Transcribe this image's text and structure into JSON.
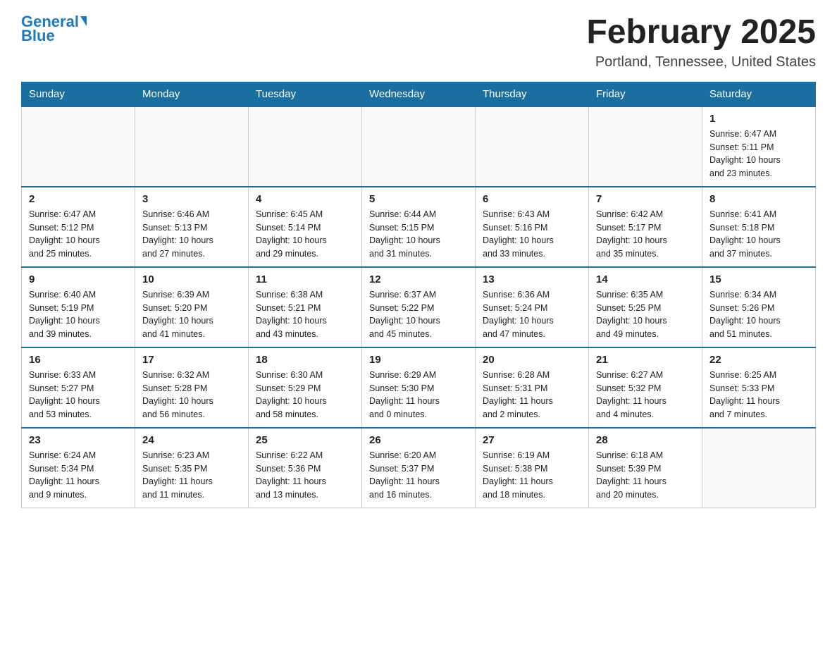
{
  "logo": {
    "general": "General",
    "blue": "Blue",
    "triangle": "▶"
  },
  "title": "February 2025",
  "location": "Portland, Tennessee, United States",
  "days_of_week": [
    "Sunday",
    "Monday",
    "Tuesday",
    "Wednesday",
    "Thursday",
    "Friday",
    "Saturday"
  ],
  "weeks": [
    [
      {
        "day": "",
        "info": ""
      },
      {
        "day": "",
        "info": ""
      },
      {
        "day": "",
        "info": ""
      },
      {
        "day": "",
        "info": ""
      },
      {
        "day": "",
        "info": ""
      },
      {
        "day": "",
        "info": ""
      },
      {
        "day": "1",
        "info": "Sunrise: 6:47 AM\nSunset: 5:11 PM\nDaylight: 10 hours\nand 23 minutes."
      }
    ],
    [
      {
        "day": "2",
        "info": "Sunrise: 6:47 AM\nSunset: 5:12 PM\nDaylight: 10 hours\nand 25 minutes."
      },
      {
        "day": "3",
        "info": "Sunrise: 6:46 AM\nSunset: 5:13 PM\nDaylight: 10 hours\nand 27 minutes."
      },
      {
        "day": "4",
        "info": "Sunrise: 6:45 AM\nSunset: 5:14 PM\nDaylight: 10 hours\nand 29 minutes."
      },
      {
        "day": "5",
        "info": "Sunrise: 6:44 AM\nSunset: 5:15 PM\nDaylight: 10 hours\nand 31 minutes."
      },
      {
        "day": "6",
        "info": "Sunrise: 6:43 AM\nSunset: 5:16 PM\nDaylight: 10 hours\nand 33 minutes."
      },
      {
        "day": "7",
        "info": "Sunrise: 6:42 AM\nSunset: 5:17 PM\nDaylight: 10 hours\nand 35 minutes."
      },
      {
        "day": "8",
        "info": "Sunrise: 6:41 AM\nSunset: 5:18 PM\nDaylight: 10 hours\nand 37 minutes."
      }
    ],
    [
      {
        "day": "9",
        "info": "Sunrise: 6:40 AM\nSunset: 5:19 PM\nDaylight: 10 hours\nand 39 minutes."
      },
      {
        "day": "10",
        "info": "Sunrise: 6:39 AM\nSunset: 5:20 PM\nDaylight: 10 hours\nand 41 minutes."
      },
      {
        "day": "11",
        "info": "Sunrise: 6:38 AM\nSunset: 5:21 PM\nDaylight: 10 hours\nand 43 minutes."
      },
      {
        "day": "12",
        "info": "Sunrise: 6:37 AM\nSunset: 5:22 PM\nDaylight: 10 hours\nand 45 minutes."
      },
      {
        "day": "13",
        "info": "Sunrise: 6:36 AM\nSunset: 5:24 PM\nDaylight: 10 hours\nand 47 minutes."
      },
      {
        "day": "14",
        "info": "Sunrise: 6:35 AM\nSunset: 5:25 PM\nDaylight: 10 hours\nand 49 minutes."
      },
      {
        "day": "15",
        "info": "Sunrise: 6:34 AM\nSunset: 5:26 PM\nDaylight: 10 hours\nand 51 minutes."
      }
    ],
    [
      {
        "day": "16",
        "info": "Sunrise: 6:33 AM\nSunset: 5:27 PM\nDaylight: 10 hours\nand 53 minutes."
      },
      {
        "day": "17",
        "info": "Sunrise: 6:32 AM\nSunset: 5:28 PM\nDaylight: 10 hours\nand 56 minutes."
      },
      {
        "day": "18",
        "info": "Sunrise: 6:30 AM\nSunset: 5:29 PM\nDaylight: 10 hours\nand 58 minutes."
      },
      {
        "day": "19",
        "info": "Sunrise: 6:29 AM\nSunset: 5:30 PM\nDaylight: 11 hours\nand 0 minutes."
      },
      {
        "day": "20",
        "info": "Sunrise: 6:28 AM\nSunset: 5:31 PM\nDaylight: 11 hours\nand 2 minutes."
      },
      {
        "day": "21",
        "info": "Sunrise: 6:27 AM\nSunset: 5:32 PM\nDaylight: 11 hours\nand 4 minutes."
      },
      {
        "day": "22",
        "info": "Sunrise: 6:25 AM\nSunset: 5:33 PM\nDaylight: 11 hours\nand 7 minutes."
      }
    ],
    [
      {
        "day": "23",
        "info": "Sunrise: 6:24 AM\nSunset: 5:34 PM\nDaylight: 11 hours\nand 9 minutes."
      },
      {
        "day": "24",
        "info": "Sunrise: 6:23 AM\nSunset: 5:35 PM\nDaylight: 11 hours\nand 11 minutes."
      },
      {
        "day": "25",
        "info": "Sunrise: 6:22 AM\nSunset: 5:36 PM\nDaylight: 11 hours\nand 13 minutes."
      },
      {
        "day": "26",
        "info": "Sunrise: 6:20 AM\nSunset: 5:37 PM\nDaylight: 11 hours\nand 16 minutes."
      },
      {
        "day": "27",
        "info": "Sunrise: 6:19 AM\nSunset: 5:38 PM\nDaylight: 11 hours\nand 18 minutes."
      },
      {
        "day": "28",
        "info": "Sunrise: 6:18 AM\nSunset: 5:39 PM\nDaylight: 11 hours\nand 20 minutes."
      },
      {
        "day": "",
        "info": ""
      }
    ]
  ]
}
